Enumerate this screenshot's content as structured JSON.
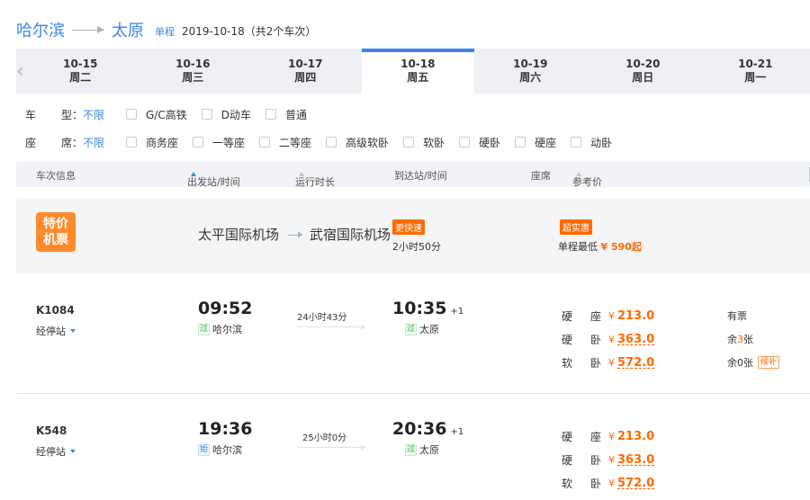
{
  "route": {
    "from": "哈尔滨",
    "to": "太原",
    "trip_type": "单程",
    "trip_info": "2019-10-18（共2个车次）"
  },
  "date_bar": {
    "days": [
      {
        "date": "10-15",
        "weekday": "周二",
        "active": false
      },
      {
        "date": "10-16",
        "weekday": "周三",
        "active": false
      },
      {
        "date": "10-17",
        "weekday": "周四",
        "active": false
      },
      {
        "date": "10-18",
        "weekday": "周五",
        "active": true
      },
      {
        "date": "10-19",
        "weekday": "周六",
        "active": false
      },
      {
        "date": "10-20",
        "weekday": "周日",
        "active": false
      },
      {
        "date": "10-21",
        "weekday": "周一",
        "active": false
      }
    ]
  },
  "filters": {
    "train_type": {
      "label_a": "车",
      "label_b": "型",
      "colon": "：",
      "selected": "不限",
      "options": [
        "G/C高铁",
        "D动车",
        "普通"
      ]
    },
    "seat_type": {
      "label_a": "座",
      "label_b": "席",
      "colon": "：",
      "selected": "不限",
      "options": [
        "商务座",
        "一等座",
        "二等座",
        "高级软卧",
        "软卧",
        "硬卧",
        "硬座",
        "动卧"
      ]
    }
  },
  "table_header": {
    "train_info": "车次信息",
    "depart": "出发站/时间",
    "duration": "运行时长",
    "arrive": "到达站/时间",
    "seat": "座席",
    "price": "参考价"
  },
  "promo": {
    "badge_line1": "特价",
    "badge_line2": "机票",
    "from_airport": "太平国际机场",
    "to_airport": "武宿国际机场",
    "fast_tag": "更快速",
    "duration": "2小时50分",
    "deal_tag": "超实惠",
    "lowest_prefix": "单程最低 ",
    "lowest_yen": "¥",
    "lowest_price": "590",
    "lowest_suffix": "起"
  },
  "trains": [
    {
      "number": "K1084",
      "stops_label": "经停站",
      "dep_time": "09:52",
      "dep_tag": "过",
      "dep_station": "哈尔滨",
      "duration": "24小时43分",
      "arr_time": "10:35",
      "arr_plus": "+1",
      "arr_tag": "过",
      "arr_station": "太原",
      "seats": [
        {
          "name_a": "硬",
          "name_b": "座",
          "yen": "¥",
          "price": "213.0"
        },
        {
          "name_a": "硬",
          "name_b": "卧",
          "yen": "¥",
          "price": "363.0"
        },
        {
          "name_a": "软",
          "name_b": "卧",
          "yen": "¥",
          "price": "572.0"
        }
      ],
      "availability": [
        "有票",
        "余",
        "3",
        "张",
        "余0张",
        "候补"
      ]
    },
    {
      "number": "K548",
      "stops_label": "经停站",
      "dep_time": "19:36",
      "dep_tag": "始",
      "dep_station": "哈尔滨",
      "duration": "25小时0分",
      "arr_time": "20:36",
      "arr_plus": "+1",
      "arr_tag": "过",
      "arr_station": "太原",
      "seats": [
        {
          "name_a": "硬",
          "name_b": "座",
          "yen": "¥",
          "price": "213.0"
        },
        {
          "name_a": "硬",
          "name_b": "卧",
          "yen": "¥",
          "price": "363.0"
        },
        {
          "name_a": "软",
          "name_b": "卧",
          "yen": "¥",
          "price": "572.0"
        }
      ]
    }
  ],
  "icons": {
    "prev": "chevron-left-icon",
    "route_arrow": "arrow-right-icon",
    "sort_active": "sort-up-icon",
    "sort": "sort-icon",
    "dropdown": "caret-down-icon"
  },
  "colors": {
    "accent": "#3b86e8",
    "price": "#ff6a00",
    "promo_badge": "#ff8a2b"
  }
}
